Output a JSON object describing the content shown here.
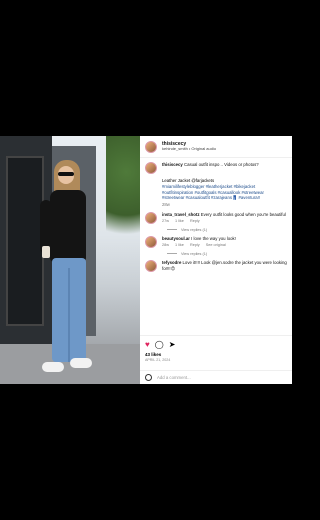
{
  "header": {
    "username": "thisiscecy",
    "subtitle": "kehinde_smith • Original audio"
  },
  "caption": {
    "username": "thisiscecy",
    "text": "Casual outfit inspo .. Videos or photos?",
    "line2": "Leather Jacket @farjackets",
    "hashtags": "#miamilifestyleblogger #leatherjacket #bikejacket #outfitinspiration #outfitgoals #casuallook #streetwear #streetwear #casualoutfit #zarajeans👖 #aventura!!",
    "time": "28w"
  },
  "comments": [
    {
      "username": "insta_travel_shotz",
      "text": "Every outfit looks good when you're beautiful",
      "time": "27w",
      "likes": "1 like",
      "reply": "Reply",
      "view_replies": "View replies (1)"
    },
    {
      "username": "beautysoul.ar",
      "text": "I love the way you look!",
      "time": "28w",
      "likes": "1 like",
      "reply": "Reply",
      "see_translation": "See original",
      "view_replies": "View replies (1)"
    },
    {
      "username": "tefysodre",
      "text": "Love it!!!! Look @jen.sodre the jacket you were looking for!!!😍",
      "time": "",
      "likes": "",
      "reply": ""
    }
  ],
  "actions": {
    "likes": "43 likes",
    "date": "APRIL 21, 2024"
  },
  "add_comment": {
    "placeholder": "Add a comment..."
  }
}
